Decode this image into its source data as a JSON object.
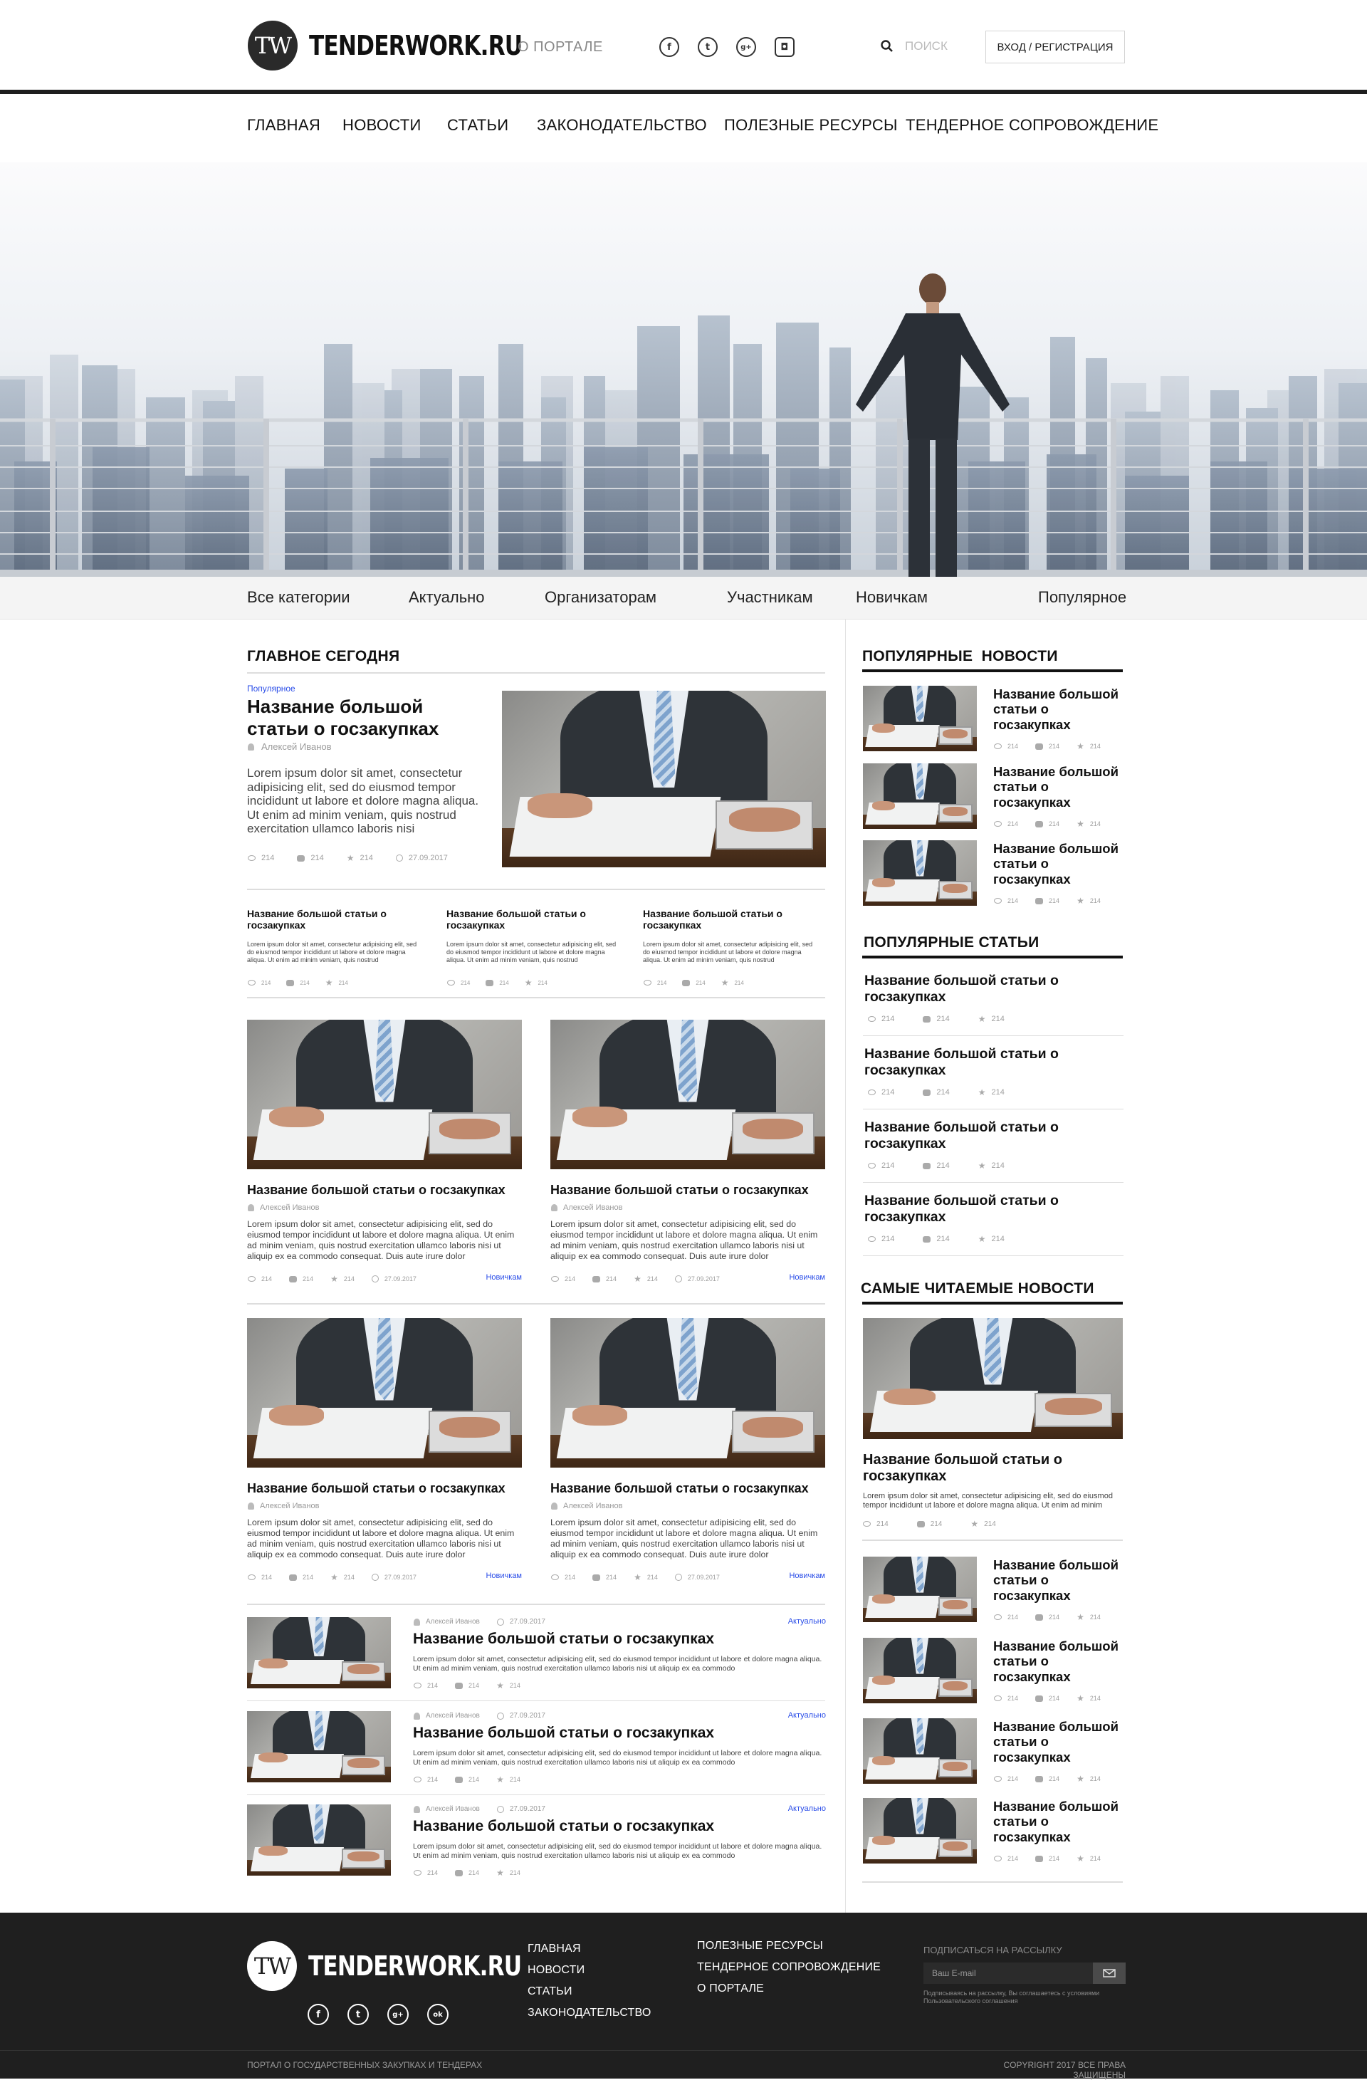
{
  "header": {
    "logo_mark": "TW",
    "logo_text": "TENDERWORK.RU",
    "about_link": "О ПОРТАЛЕ",
    "social": [
      {
        "icon": "facebook-icon",
        "glyph": "f"
      },
      {
        "icon": "twitter-icon",
        "glyph": "t"
      },
      {
        "icon": "google-plus-icon",
        "glyph": "g+"
      },
      {
        "icon": "instagram-icon",
        "glyph": "◘"
      }
    ],
    "search_placeholder": "ПОИСК",
    "login_button": "ВХОД / РЕГИСТРАЦИЯ"
  },
  "nav": [
    "ГЛАВНАЯ",
    "НОВОСТИ",
    "СТАТЬИ",
    "ЗАКОНОДАТЕЛЬСТВО",
    "ПОЛЕЗНЫЕ РЕСУРСЫ",
    "ТЕНДЕРНОЕ СОПРОВОЖДЕНИЕ"
  ],
  "categories": [
    "Все категории",
    "Актуально",
    "Организаторам",
    "Участникам",
    "Новичкам",
    "Популярное"
  ],
  "main": {
    "section_title": "ГЛАВНОЕ СЕГОДНЯ",
    "featured": {
      "tag": "Популярное",
      "title": "Название большой статьи о госзакупках",
      "author": "Алексей Иванов",
      "text": "Lorem ipsum dolor sit amet, consectetur adipisicing elit, sed do eiusmod tempor incididunt ut labore et dolore magna aliqua. Ut enim ad minim veniam, quis nostrud exercitation ullamco laboris nisi",
      "views": "214",
      "comments": "214",
      "stars": "214",
      "date": "27.09.2017"
    },
    "small_articles": [
      {
        "title": "Название большой статьи о госзакупках",
        "text": "Lorem ipsum dolor sit amet, consectetur adipisicing elit, sed do eiusmod tempor incididunt ut labore et dolore magna aliqua. Ut enim ad minim veniam, quis nostrud",
        "views": "214",
        "comments": "214",
        "stars": "214"
      },
      {
        "title": "Название большой статьи о госзакупках",
        "text": "Lorem ipsum dolor sit amet, consectetur adipisicing elit, sed do eiusmod tempor incididunt ut labore et dolore magna aliqua. Ut enim ad minim veniam, quis nostrud",
        "views": "214",
        "comments": "214",
        "stars": "214"
      },
      {
        "title": "Название большой статьи о госзакупках",
        "text": "Lorem ipsum dolor sit amet, consectetur adipisicing elit, sed do eiusmod tempor incididunt ut labore et dolore magna aliqua. Ut enim ad minim veniam, quis nostrud",
        "views": "214",
        "comments": "214",
        "stars": "214"
      }
    ],
    "grid_articles": [
      {
        "title": "Название большой статьи о госзакупках",
        "author": "Алексей Иванов",
        "text": "Lorem ipsum dolor sit amet, consectetur adipisicing elit, sed do eiusmod tempor incididunt ut labore et dolore magna aliqua. Ut enim ad minim veniam, quis nostrud exercitation ullamco laboris nisi ut aliquip ex ea commodo consequat. Duis aute irure dolor",
        "views": "214",
        "comments": "214",
        "stars": "214",
        "date": "27.09.2017",
        "tag": "Новичкам"
      },
      {
        "title": "Название большой статьи о госзакупках",
        "author": "Алексей Иванов",
        "text": "Lorem ipsum dolor sit amet, consectetur adipisicing elit, sed do eiusmod tempor incididunt ut labore et dolore magna aliqua. Ut enim ad minim veniam, quis nostrud exercitation ullamco laboris nisi ut aliquip ex ea commodo consequat. Duis aute irure dolor",
        "views": "214",
        "comments": "214",
        "stars": "214",
        "date": "27.09.2017",
        "tag": "Новичкам"
      },
      {
        "title": "Название большой статьи о госзакупках",
        "author": "Алексей Иванов",
        "text": "Lorem ipsum dolor sit amet, consectetur adipisicing elit, sed do eiusmod tempor incididunt ut labore et dolore magna aliqua. Ut enim ad minim veniam, quis nostrud exercitation ullamco laboris nisi ut aliquip ex ea commodo consequat. Duis aute irure dolor",
        "views": "214",
        "comments": "214",
        "stars": "214",
        "date": "27.09.2017",
        "tag": "Новичкам"
      },
      {
        "title": "Название большой статьи о госзакупках",
        "author": "Алексей Иванов",
        "text": "Lorem ipsum dolor sit amet, consectetur adipisicing elit, sed do eiusmod tempor incididunt ut labore et dolore magna aliqua. Ut enim ad minim veniam, quis nostrud exercitation ullamco laboris nisi ut aliquip ex ea commodo consequat. Duis aute irure dolor",
        "views": "214",
        "comments": "214",
        "stars": "214",
        "date": "27.09.2017",
        "tag": "Новичкам"
      }
    ],
    "list_articles": [
      {
        "author": "Алексей Иванов",
        "date": "27.09.2017",
        "tag": "Актуально",
        "title": "Название большой статьи о госзакупках",
        "text": "Lorem ipsum dolor sit amet, consectetur adipisicing elit, sed do eiusmod tempor incididunt ut labore et dolore magna aliqua. Ut enim ad minim veniam, quis nostrud exercitation ullamco laboris nisi ut aliquip ex ea commodo",
        "views": "214",
        "comments": "214",
        "stars": "214"
      },
      {
        "author": "Алексей Иванов",
        "date": "27.09.2017",
        "tag": "Актуально",
        "title": "Название большой статьи о госзакупках",
        "text": "Lorem ipsum dolor sit amet, consectetur adipisicing elit, sed do eiusmod tempor incididunt ut labore et dolore magna aliqua. Ut enim ad minim veniam, quis nostrud exercitation ullamco laboris nisi ut aliquip ex ea commodo",
        "views": "214",
        "comments": "214",
        "stars": "214"
      },
      {
        "author": "Алексей Иванов",
        "date": "27.09.2017",
        "tag": "Актуально",
        "title": "Название большой статьи о госзакупках",
        "text": "Lorem ipsum dolor sit amet, consectetur adipisicing elit, sed do eiusmod tempor incididunt ut labore et dolore magna aliqua. Ut enim ad minim veniam, quis nostrud exercitation ullamco laboris nisi ut aliquip ex ea commodo",
        "views": "214",
        "comments": "214",
        "stars": "214"
      }
    ]
  },
  "sidebar": {
    "popular_news_title": "ПОПУЛЯРНЫЕ  НОВОСТИ",
    "popular_news": [
      {
        "title": "Название большой статьи о госзакупках",
        "views": "214",
        "comments": "214",
        "stars": "214"
      },
      {
        "title": "Название большой статьи о госзакупках",
        "views": "214",
        "comments": "214",
        "stars": "214"
      },
      {
        "title": "Название большой статьи о госзакупках",
        "views": "214",
        "comments": "214",
        "stars": "214"
      }
    ],
    "popular_articles_title": "ПОПУЛЯРНЫЕ СТАТЬИ",
    "popular_articles": [
      {
        "title": "Название большой статьи о госзакупках",
        "views": "214",
        "comments": "214",
        "stars": "214"
      },
      {
        "title": "Название большой статьи о госзакупках",
        "views": "214",
        "comments": "214",
        "stars": "214"
      },
      {
        "title": "Название большой статьи о госзакупках",
        "views": "214",
        "comments": "214",
        "stars": "214"
      },
      {
        "title": "Название большой статьи о госзакупках",
        "views": "214",
        "comments": "214",
        "stars": "214"
      }
    ],
    "most_read_title": "САМЫЕ ЧИТАЕМЫЕ НОВОСТИ",
    "most_read_main": {
      "title": "Название большой статьи о госзакупках",
      "text": "Lorem ipsum dolor sit amet, consectetur adipisicing elit, sed do eiusmod tempor incididunt ut labore et dolore magna aliqua. Ut enim ad minim",
      "views": "214",
      "comments": "214",
      "stars": "214"
    },
    "most_read": [
      {
        "title": "Название большой статьи о госзакупках",
        "views": "214",
        "comments": "214",
        "stars": "214"
      },
      {
        "title": "Название большой статьи о госзакупках",
        "views": "214",
        "comments": "214",
        "stars": "214"
      },
      {
        "title": "Название большой статьи о госзакупках",
        "views": "214",
        "comments": "214",
        "stars": "214"
      },
      {
        "title": "Название большой статьи о госзакупках",
        "views": "214",
        "comments": "214",
        "stars": "214"
      }
    ]
  },
  "footer": {
    "logo_mark": "TW",
    "logo_text": "TENDERWORK.RU",
    "social": [
      {
        "icon": "facebook-icon",
        "glyph": "f"
      },
      {
        "icon": "twitter-icon",
        "glyph": "t"
      },
      {
        "icon": "google-plus-icon",
        "glyph": "g+"
      },
      {
        "icon": "odnoklassniki-icon",
        "glyph": "ok"
      }
    ],
    "links_col1": [
      "ГЛАВНАЯ",
      "НОВОСТИ",
      "СТАТЬИ",
      "ЗАКОНОДАТЕЛЬСТВО"
    ],
    "links_col2": [
      "ПОЛЕЗНЫЕ РЕСУРСЫ",
      "ТЕНДЕРНОЕ СОПРОВОЖДЕНИЕ",
      "О ПОРТАЛЕ"
    ],
    "subscribe_title": "ПОДПИСАТЬСЯ НА РАССЫЛКУ",
    "email_placeholder": "Ваш E-mail",
    "subscribe_note": "Подписываясь на рассылку, Вы соглашаетесь с условиями Пользовательского соглашения",
    "bottom_left": "ПОРТАЛ О ГОСУДАРСТВЕННЫХ ЗАКУПКАХ И ТЕНДЕРАХ",
    "bottom_right": "COPYRIGHT 2017 ВСЕ ПРАВА ЗАЩИЩЕНЫ"
  }
}
